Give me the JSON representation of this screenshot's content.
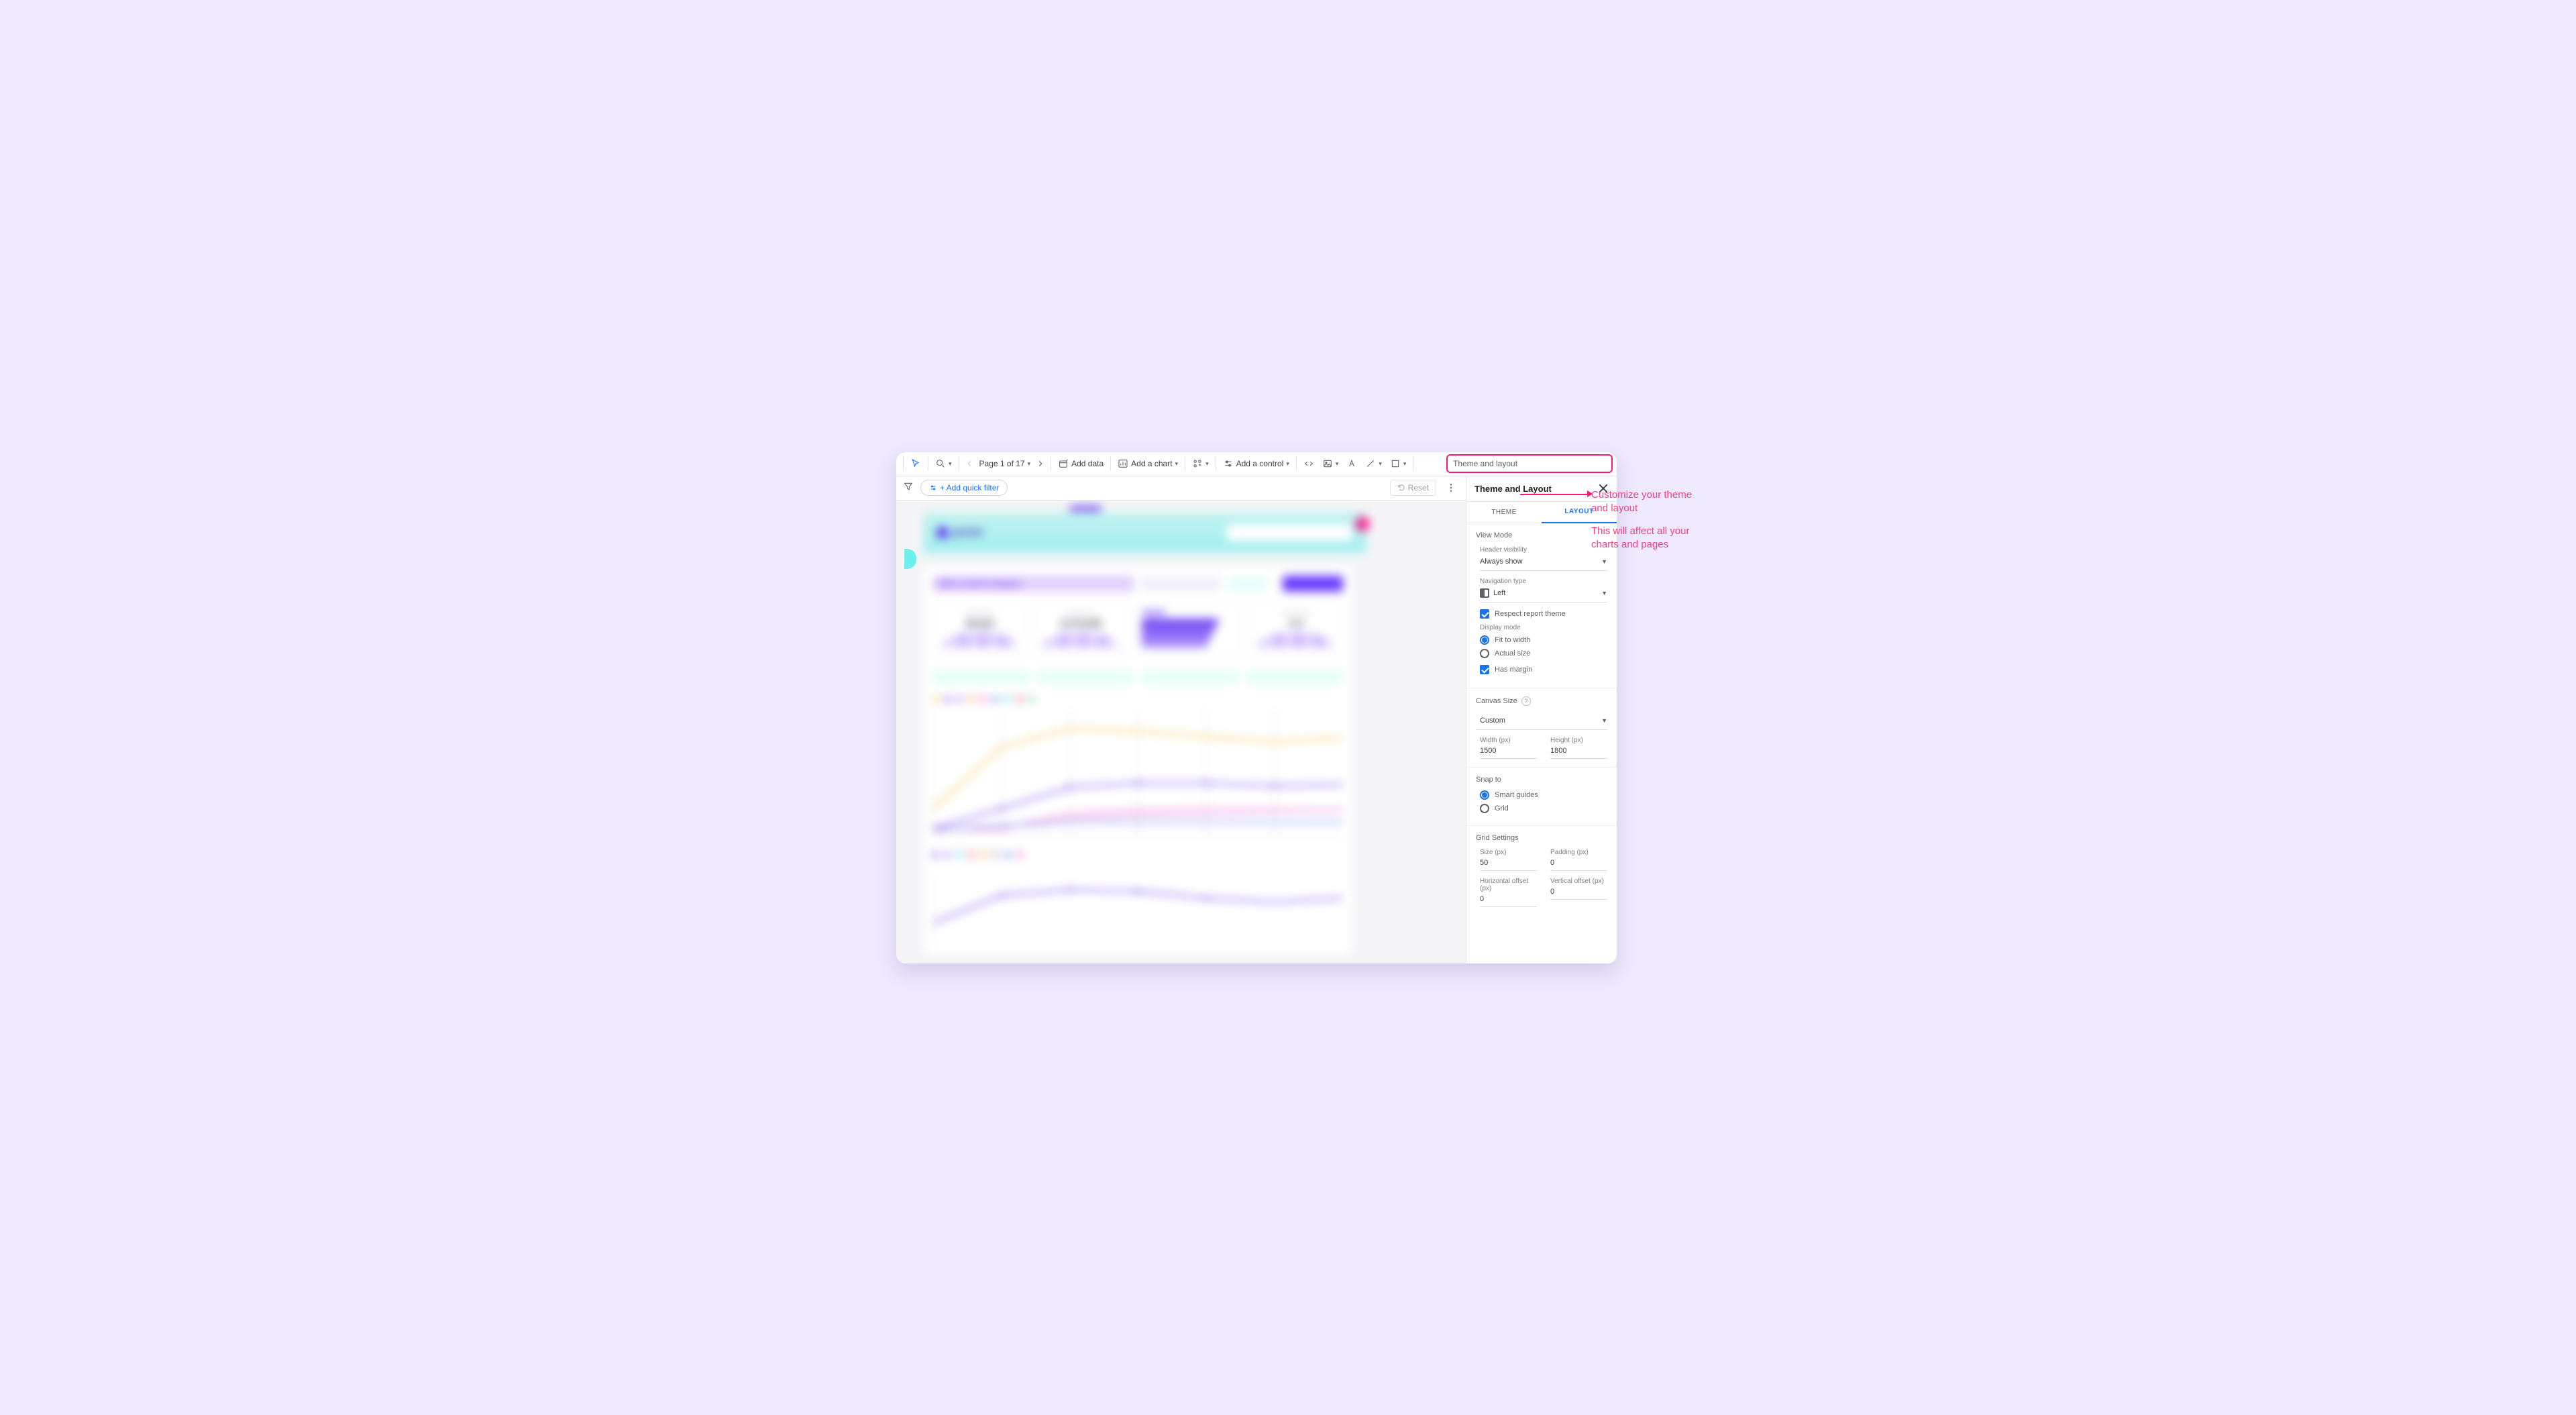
{
  "toolbar": {
    "page_label": "Page 1 of 17",
    "add_data": "Add data",
    "add_chart": "Add a chart",
    "add_control": "Add a control",
    "theme_box": "Theme and layout"
  },
  "filterbar": {
    "quick_filter": "+ Add quick filter",
    "reset": "Reset"
  },
  "panel": {
    "title": "Theme and Layout",
    "tabs": {
      "theme": "THEME",
      "layout": "LAYOUT"
    },
    "view_mode": "View Mode",
    "header_visibility": {
      "label": "Header visibility",
      "value": "Always show"
    },
    "nav_type": {
      "label": "Navigation type",
      "value": "Left"
    },
    "respect_theme": "Respect report theme",
    "display_mode": {
      "label": "Display mode",
      "fit": "Fit to width",
      "actual": "Actual size"
    },
    "has_margin": "Has margin",
    "canvas": {
      "title": "Canvas Size",
      "value": "Custom",
      "width_label": "Width (px)",
      "width": "1500",
      "height_label": "Height (px)",
      "height": "1800"
    },
    "snap": {
      "title": "Snap to",
      "smart": "Smart guides",
      "grid": "Grid"
    },
    "grid": {
      "title": "Grid Settings",
      "size_label": "Size (px)",
      "size": "50",
      "padding_label": "Padding (px)",
      "padding": "0",
      "hoff_label": "Horizontal offset (px)",
      "hoff": "0",
      "voff_label": "Vertical offset (px)",
      "voff": "0"
    }
  },
  "callout": {
    "l1": "Customize your theme and layout",
    "l2": "This will affect all your charts and pages"
  }
}
